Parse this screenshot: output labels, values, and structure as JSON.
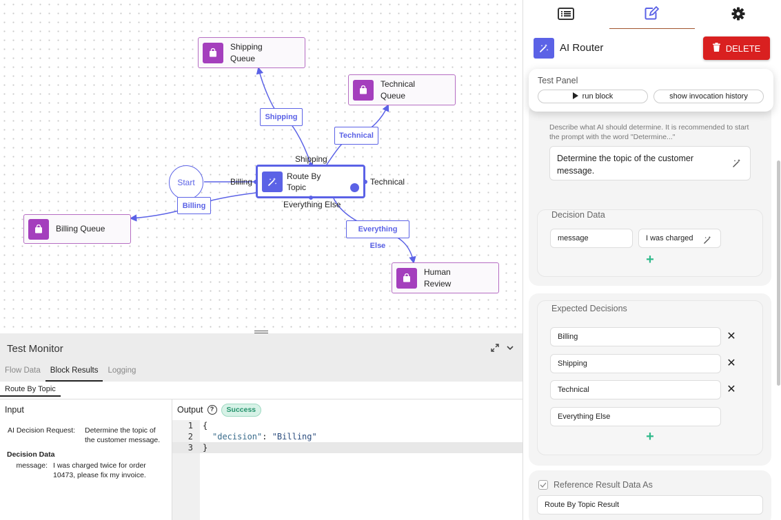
{
  "canvas": {
    "start": "Start",
    "router": {
      "label": "Route By Topic"
    },
    "nodes": {
      "shipping": "Shipping Queue",
      "technical": "Technical Queue",
      "billing": "Billing Queue",
      "human": "Human Review"
    },
    "edge_labels": {
      "shipping": "Shipping",
      "technical": "Technical",
      "billing": "Billing",
      "everything_else": "Everything Else"
    },
    "ports": {
      "top": "Shipping",
      "left": "Billing",
      "right": "Technical",
      "bottom": "Everything Else"
    }
  },
  "monitor": {
    "title": "Test Monitor",
    "tabs": [
      "Flow Data",
      "Block Results",
      "Logging"
    ],
    "active_tab": "Block Results",
    "subtab": "Route By Topic",
    "input": {
      "header": "Input",
      "request_key": "AI Decision Request:",
      "request_value": "Determine the topic of the customer message.",
      "decision_data_label": "Decision Data",
      "message_key": "message:",
      "message_value": "I was charged twice for order 10473, please fix my invoice."
    },
    "output": {
      "header": "Output",
      "help": "?",
      "status": "Success",
      "lines": [
        {
          "n": "1",
          "text": "{"
        },
        {
          "n": "2",
          "key": "\"decision\"",
          "value": "\"Billing\""
        },
        {
          "n": "3",
          "text": "}"
        }
      ]
    }
  },
  "panel": {
    "tab_icons": [
      "list-icon",
      "edit-icon",
      "gear-icon"
    ],
    "block_title": "AI Router",
    "delete_label": "DELETE",
    "test_panel": {
      "title": "Test Panel",
      "run_label": "run block",
      "history_label": "show invocation history"
    },
    "prompt_help": "Describe what AI should determine. It is recommended to start the prompt with the word \"Determine...\"",
    "prompt_value": "Determine the topic of the customer message.",
    "decision_data": {
      "label": "Decision Data",
      "key": "message",
      "value": "I was charged"
    },
    "expected_decisions": {
      "label": "Expected Decisions",
      "items": [
        "Billing",
        "Shipping",
        "Technical",
        "Everything Else"
      ]
    },
    "reference": {
      "label": "Reference Result Data As",
      "value": "Route By Topic Result"
    }
  },
  "colors": {
    "accent": "#5b62e6",
    "queue": "#a43fbd",
    "delete": "#d92020",
    "success": "#23926b",
    "add": "#2fb98a"
  }
}
